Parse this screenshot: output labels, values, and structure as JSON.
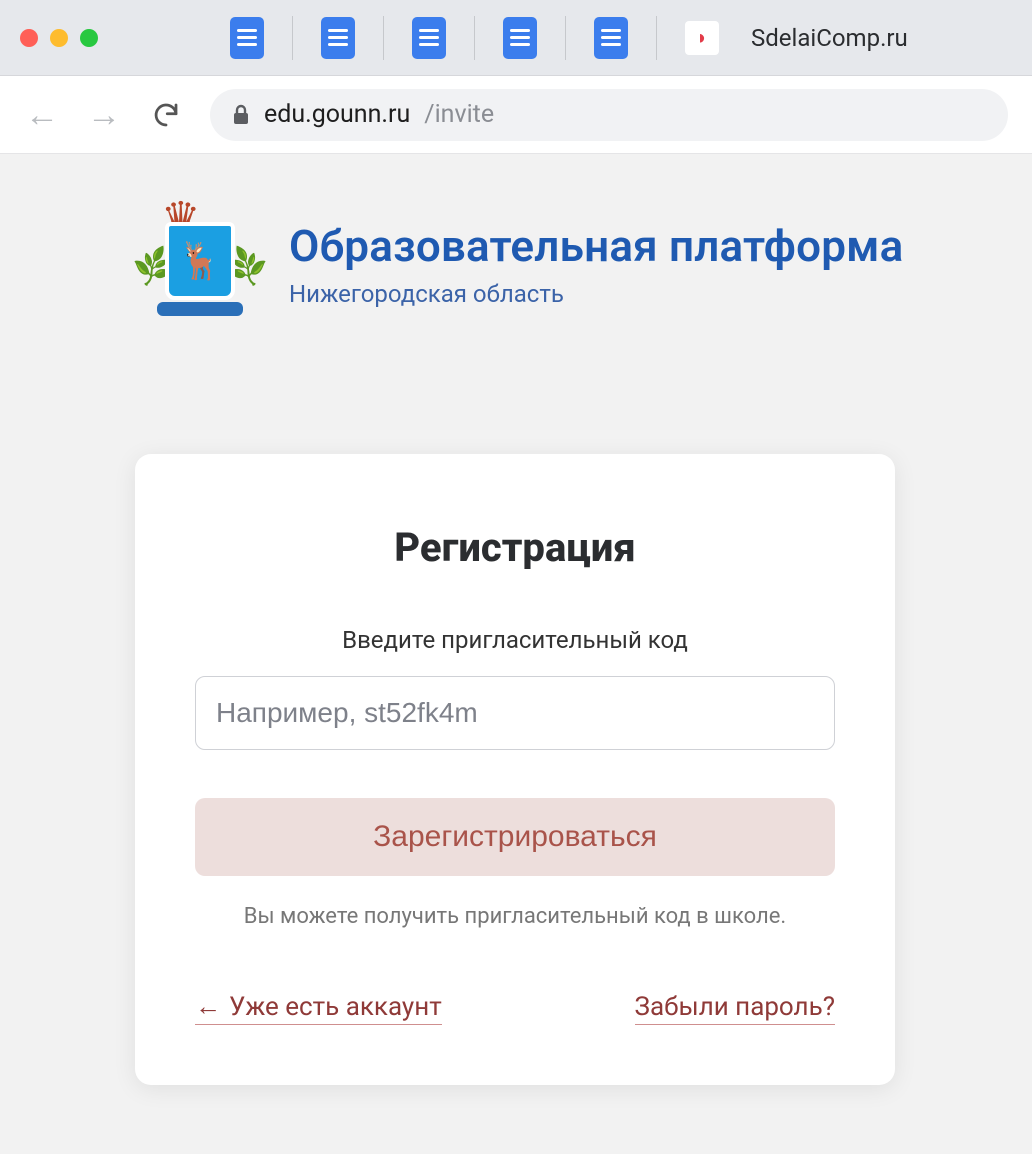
{
  "browser": {
    "tab_title": "SdelaiComp.ru",
    "url_host": "edu.gounn.ru",
    "url_path": "/invite"
  },
  "brand": {
    "title": "Образовательная платформа",
    "subtitle": "Нижегородская область"
  },
  "card": {
    "heading": "Регистрация",
    "instruction": "Введите пригласительный код",
    "input_placeholder": "Например, st52fk4m",
    "submit_label": "Зарегистрироваться",
    "hint": "Вы можете получить пригласительный код в школе.",
    "back_link": "Уже есть аккаунт",
    "forgot_link": "Забыли пароль?"
  }
}
